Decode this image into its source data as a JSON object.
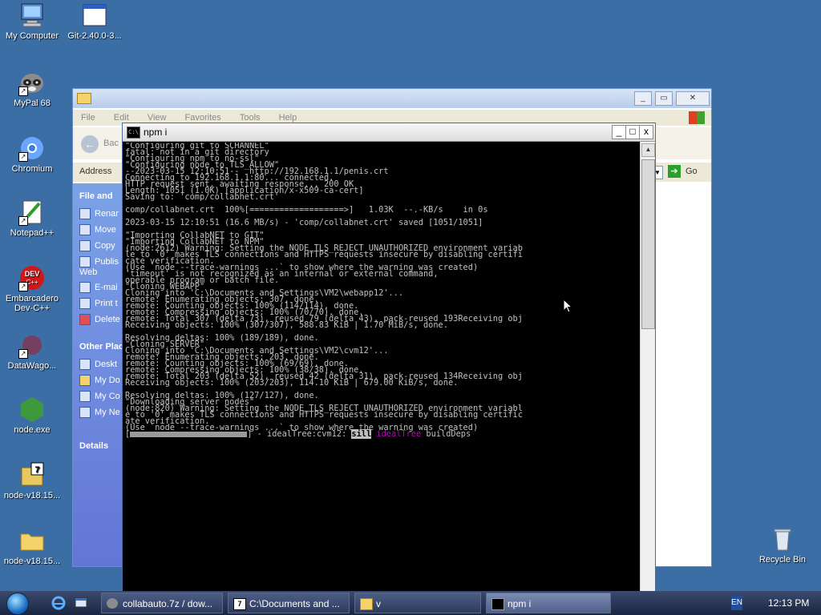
{
  "desktop_icons": [
    {
      "label": "My Computer"
    },
    {
      "label": "Git-2.40.0-3..."
    },
    {
      "label": "MyPal 68"
    },
    {
      "label": "Chromium"
    },
    {
      "label": "Notepad++"
    },
    {
      "label": "Embarcadero Dev-C++"
    },
    {
      "label": "DataWago..."
    },
    {
      "label": "node.exe"
    },
    {
      "label": "node-v18.15..."
    },
    {
      "label": "node-v18.15..."
    },
    {
      "label": "Recycle Bin"
    }
  ],
  "explorer": {
    "menu": [
      "File",
      "Edit",
      "View",
      "Favorites",
      "Tools",
      "Help"
    ],
    "back_label": "Bac",
    "address_label": "Address",
    "go_label": "Go",
    "file_folder_tasks": "File and",
    "tasks": [
      "Renar",
      "Move",
      "Copy",
      "Publis Web",
      "E-mai",
      "Print t",
      "Delete"
    ],
    "other_places": "Other Plac",
    "places": [
      "Deskt",
      "My Do",
      "My Co",
      "My Ne"
    ],
    "details": "Details"
  },
  "console": {
    "title": "npm i",
    "icon_text": "C:\\",
    "min": "_",
    "max": "□",
    "close": "x",
    "lines": [
      "\"Configuring git to SCHANNEL\"",
      "fatal: not in a git directory",
      "\"Configuring npm to no-ssl\"",
      "\"Configuring node to TLS_ALLOW\"",
      "--2023-03-15 12:10:51--  http://192.168.1.1/penis.crt",
      "Connecting to 192.168.1.1:80... connected.",
      "HTTP request sent, awaiting response... 200 OK",
      "Length: 1051 (1.0K) [application/x-x509-ca-cert]",
      "Saving to: 'comp/collabnet.crt'",
      "",
      "comp/collabnet.crt  100%[===================>]   1.03K  --.-KB/s    in 0s",
      "",
      "2023-03-15 12:10:51 (16.6 MB/s) - 'comp/collabnet.crt' saved [1051/1051]",
      "",
      "\"Importing CollabNET to GIT\"",
      "\"Importing CollabNET to NPM\"",
      "(node:2612) Warning: Setting the NODE_TLS_REJECT_UNAUTHORIZED environment variab",
      "le to '0' makes TLS connections and HTTPS requests insecure by disabling certifi",
      "cate verification.",
      "(Use `node --trace-warnings ...` to show where the warning was created)",
      "'timeout' is not recognized as an internal or external command,",
      "operable program or batch file.",
      "\"Cloning WEBAPP\"",
      "Cloning into 'C:\\Documents and Settings\\VM2\\webapp12'...",
      "remote: Enumerating objects: 307, done.",
      "remote: Counting objects: 100% (114/114), done.",
      "remote: Compressing objects: 100% (70/70), done.",
      "remote: Total 307 (delta 73), reused 79 (delta 43), pack-reused 193Receiving obj",
      "Receiving objects: 100% (307/307), 588.83 KiB | 1.70 MiB/s, done.",
      "",
      "Resolving deltas: 100% (189/189), done.",
      "\"Cloning SERVER\"",
      "Cloning into 'C:\\Documents and Settings\\VM2\\cvm12'...",
      "remote: Enumerating objects: 203, done.",
      "remote: Counting objects: 100% (69/69), done.",
      "remote: Compressing objects: 100% (38/38), done.",
      "remote: Total 203 (delta 52), reused 42 (delta 31), pack-reused 134Receiving obj",
      "Receiving objects: 100% (203/203), 114.10 KiB | 679.00 KiB/s, done.",
      "",
      "Resolving deltas: 100% (127/127), done.",
      "\"Downloading server nodes\"",
      "(node:820) Warning: Setting the NODE_TLS_REJECT_UNAUTHORIZED environment variabl",
      "e to '0' makes TLS connections and HTTPS requests insecure by disabling certific",
      "ate verification.",
      "(Use `node --trace-warnings ...` to show where the warning was created)"
    ],
    "progress": {
      "open": "[",
      "close": "] - idealTree:cvm12: ",
      "spinner": "sill",
      "stage": "idealTree",
      "detail": " buildDeps"
    }
  },
  "taskbar": {
    "tasks": [
      {
        "label": "collabauto.7z / dow..."
      },
      {
        "label": "C:\\Documents and ..."
      },
      {
        "label": "v"
      },
      {
        "label": "npm i"
      }
    ],
    "lang": "EN",
    "clock": "12:13 PM"
  }
}
